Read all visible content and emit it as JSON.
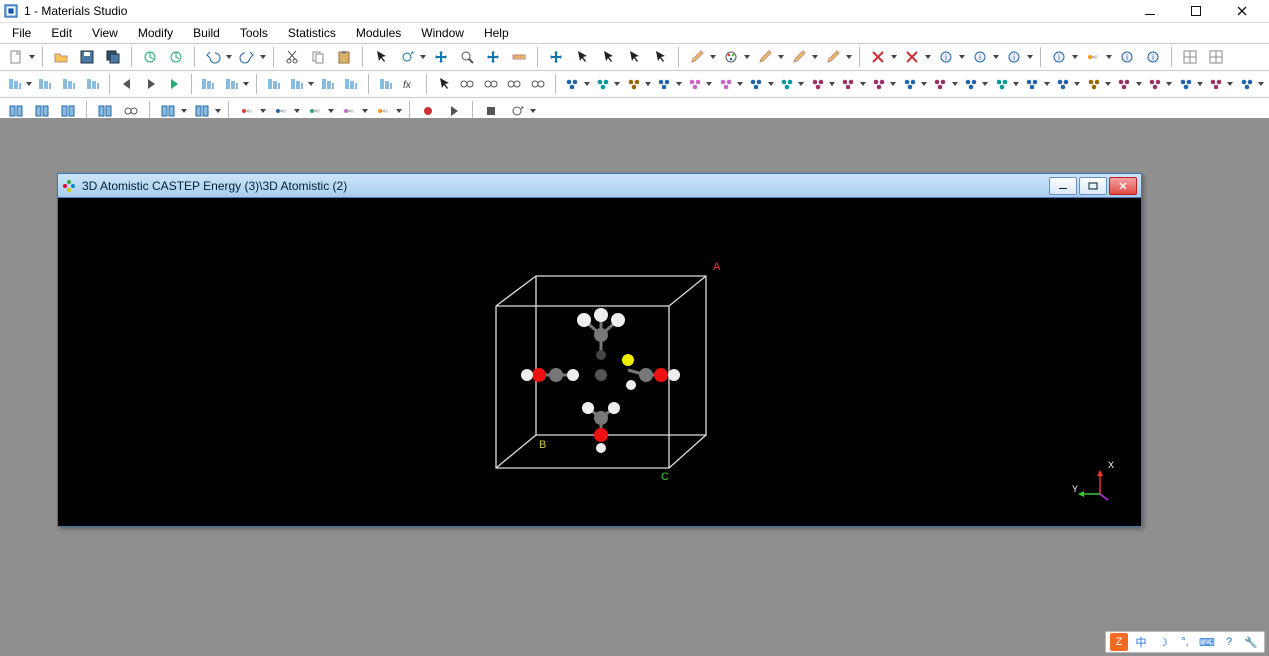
{
  "window": {
    "title": "1 - Materials Studio"
  },
  "menus": [
    "File",
    "Edit",
    "View",
    "Modify",
    "Build",
    "Tools",
    "Statistics",
    "Modules",
    "Window",
    "Help"
  ],
  "document": {
    "title": "3D Atomistic CASTEP Energy (3)\\3D Atomistic (2)",
    "axis": {
      "x": "X",
      "y": "Y"
    },
    "cell_labels": {
      "a": "A",
      "b": "B",
      "c": "C"
    }
  },
  "ime": {
    "orange": "Z",
    "mode": "中",
    "moon": "☽",
    "punct": "°,",
    "kb": "⌨",
    "help": "?",
    "wrench": "🔧"
  },
  "icons": {
    "row1": [
      "new",
      "open",
      "save",
      "save-all",
      "import",
      "refresh",
      "undo",
      "redo",
      "cut",
      "copy",
      "paste",
      "cursor",
      "rotate",
      "pan",
      "zoom",
      "zoom-fit",
      "measure",
      "center",
      "pick",
      "pick-atom",
      "pick-bond",
      "pick-box",
      "pencil",
      "color",
      "bond-edit",
      "angle-edit",
      "dihedral",
      "delete-atom",
      "delete-bond",
      "fragment",
      "charge",
      "label",
      "h-add",
      "atom-style",
      "highlight",
      "info",
      "grid",
      "grid2"
    ],
    "row2": [
      "xyz1",
      "xyz2",
      "xyz3",
      "xyz4",
      "prev",
      "next",
      "play",
      "iso",
      "layers-a",
      "layers-b",
      "angle-a",
      "angle-b",
      "select-a",
      "select-b",
      "fx",
      "ptr",
      "link",
      "node",
      "torus",
      "home",
      "m-elec",
      "m-dyn",
      "m-amorph",
      "m-poly",
      "m-crystal",
      "m-forcite",
      "m-meso",
      "m-opt",
      "m-morph",
      "m-cosmo",
      "m-gauss",
      "m-refl",
      "m-sorpt",
      "m-vamp",
      "m-ana",
      "m-cast",
      "m-dmol",
      "m-onetep",
      "m-qmera",
      "m-chart",
      "m-stat",
      "m-table",
      "m-post"
    ],
    "row3": [
      "win-tile-h",
      "win-tile-v",
      "win-cascade",
      "win-dup",
      "win-link",
      "win-group",
      "win-rebuild",
      "atom-a",
      "atom-b",
      "atom-c",
      "atom-d",
      "atom-e",
      "rec",
      "fwd",
      "stop",
      "loop"
    ]
  }
}
